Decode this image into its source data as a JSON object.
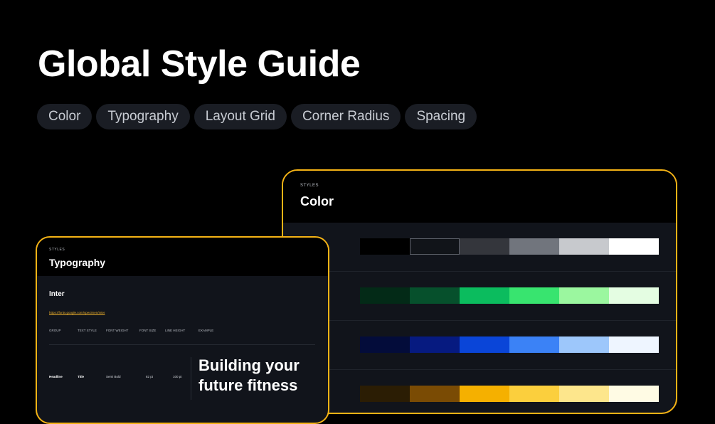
{
  "header": {
    "title": "Global Style Guide"
  },
  "tabs": [
    {
      "label": "Color"
    },
    {
      "label": "Typography"
    },
    {
      "label": "Layout Grid"
    },
    {
      "label": "Corner Radius"
    },
    {
      "label": "Spacing"
    }
  ],
  "color_card": {
    "eyebrow": "STYLES",
    "title": "Color",
    "palettes": [
      [
        "#000000",
        "#111419",
        "#34363c",
        "#71757d",
        "#c7c9cd",
        "#ffffff"
      ],
      [
        "#032a17",
        "#06502c",
        "#0bbc5e",
        "#38e46f",
        "#9bf79f",
        "#e4fde2"
      ],
      [
        "#030c3a",
        "#061a80",
        "#0a45d8",
        "#3b82f6",
        "#9dc7fb",
        "#eef5ff"
      ],
      [
        "#2b1d04",
        "#7a4b04",
        "#f5b000",
        "#fbcf3d",
        "#fde68c",
        "#fffbe4"
      ]
    ]
  },
  "typography_card": {
    "eyebrow": "STYLES",
    "title": "Typography",
    "font_name": "Inter",
    "font_link": "https://fonts.google.com/specimen/Inter",
    "columns": [
      "GROUP",
      "TEXT STYLE",
      "FONT WEIGHT",
      "FONT SIZE",
      "LINE HEIGHT",
      "EXAMPLE"
    ],
    "row": {
      "group": "Headline",
      "text_style": "Title",
      "font_weight": "Semi Bold",
      "font_size": "82 pt",
      "line_height": "100 pt",
      "example": "Building your future fitness"
    }
  },
  "colors": {
    "accent": "#f5b315",
    "chip_bg": "#1a1d24",
    "card_bg": "#11141b"
  }
}
